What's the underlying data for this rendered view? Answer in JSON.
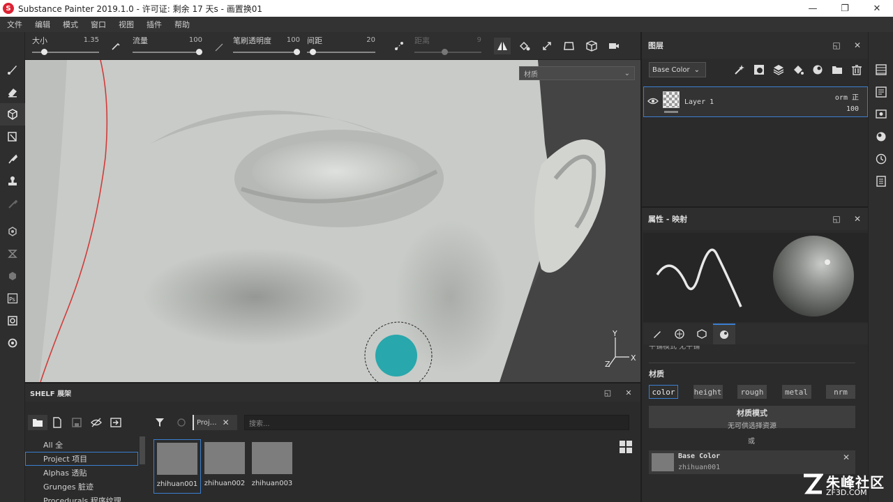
{
  "window": {
    "title": "Substance Painter 2019.1.0 - 许可证: 剩余 17 天s - 画置换01",
    "logo_glyph": "S",
    "minimize": "—",
    "maximize": "❐",
    "close": "✕"
  },
  "menu": [
    "文件",
    "编辑",
    "模式",
    "窗口",
    "视图",
    "插件",
    "帮助"
  ],
  "left_tools": [
    "paint-brush-icon",
    "eraser-icon",
    "projection-icon",
    "polygon-fill-icon",
    "smudge-icon",
    "clone-stamp-icon",
    "color-picker-icon",
    "bake-icon",
    "geometry-mask-icon",
    "id-mask-icon",
    "photoshop-icon",
    "preview-icon",
    "settings-icon"
  ],
  "tool_params": {
    "size": {
      "label": "大小",
      "value": "1.35",
      "level": 0.15
    },
    "flow": {
      "label": "流量",
      "value": "100",
      "level": 1.0
    },
    "stroke_opacity": {
      "label": "笔刷透明度",
      "value": "100",
      "level": 1.0
    },
    "spacing": {
      "label": "间距",
      "value": "20",
      "level": 0.05
    },
    "distance": {
      "label": "距离",
      "value": "9",
      "level": 0.45
    }
  },
  "viewport": {
    "material_dropdown": "材质",
    "axis_x": "X",
    "axis_y": "Y",
    "axis_z": "Z"
  },
  "shelf": {
    "title": "SHELF 展架",
    "categories": [
      "All 全",
      "Project 项目",
      "Alphas 透贴",
      "Grunges 脏迹",
      "Procedurals 程序纹理"
    ],
    "filter_tag": "Proj…",
    "search_placeholder": "搜索...",
    "assets": [
      "zhihuan001",
      "zhihuan002",
      "zhihuan003"
    ]
  },
  "layers": {
    "title": "图层",
    "channel": "Base Color",
    "layer_name": "Layer 1",
    "blend_mode": "orm 正",
    "opacity": "100"
  },
  "properties": {
    "title": "属性 - 映射",
    "material_label": "材质",
    "channels": [
      "color",
      "height",
      "rough",
      "metal",
      "nrm"
    ],
    "material_mode_title": "材质模式",
    "material_mode_sub": "无可供选择资源",
    "or_label": "或",
    "slot_title": "Base Color",
    "slot_value": "zhihuan001",
    "partial_row": "平铺模式 无平铺"
  },
  "watermark": {
    "main": "朱峰社区",
    "sub": "ZF3D.COM"
  },
  "colors": {
    "accent": "#3b7fd2",
    "panel": "#2b2b2b",
    "brush_cursor": "#16a3a8"
  }
}
